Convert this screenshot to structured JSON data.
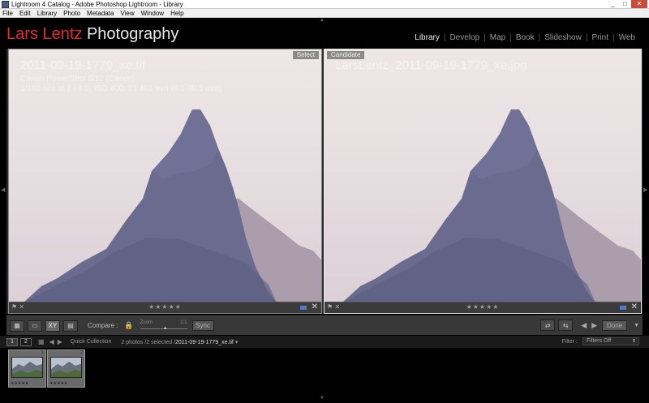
{
  "window": {
    "title": "Lightroom 4 Catalog - Adobe Photoshop Lightroom - Library",
    "controls": [
      "_",
      "□",
      "✕"
    ]
  },
  "menubar": [
    "File",
    "Edit",
    "Library",
    "Photo",
    "Metadata",
    "View",
    "Window",
    "Help"
  ],
  "identity": {
    "part1": "Lars Lentz",
    "part2": "Photography",
    "color_red": "#e42b2b"
  },
  "modules": [
    {
      "label": "Library",
      "active": true
    },
    {
      "label": "Develop"
    },
    {
      "label": "Map"
    },
    {
      "label": "Book"
    },
    {
      "label": "Slideshow"
    },
    {
      "label": "Print"
    },
    {
      "label": "Web"
    }
  ],
  "compare": {
    "select": {
      "tag": "Select",
      "filename": "2011-09-19-1779_xe.tif",
      "camera": "Canon PowerShot G12 (Canon)",
      "exposure": "1/160 sec at ƒ / 4.0, ISO 400, 21.461 mm (6.1-30.5 mm)",
      "stars": "★★★★★"
    },
    "candidate": {
      "tag": "Candidate",
      "filename": "LarsLentz_2011-09-19-1779_xe.jpg",
      "stars": "★★★★★"
    }
  },
  "toolbar": {
    "compare_label": "Compare :",
    "zoom_label": "Zoom",
    "zoom_max": "1:1",
    "sync_label": "Sync",
    "done_label": "Done"
  },
  "filmstrip_header": {
    "monitor1": "1",
    "monitor2": "2",
    "source": "Quick Collection",
    "count": "2 photos /2 selected /",
    "current_file": "2011-09-19-1779_xe.tif",
    "filter_label": "Filter :",
    "filter_value": "Filters Off"
  },
  "thumbnails": [
    {
      "index": "1",
      "stars": "★★★★★"
    },
    {
      "index": "2",
      "stars": "★★★★★"
    }
  ],
  "colors": {
    "accent_blue": "#4a7bd0",
    "background": "#000000"
  }
}
